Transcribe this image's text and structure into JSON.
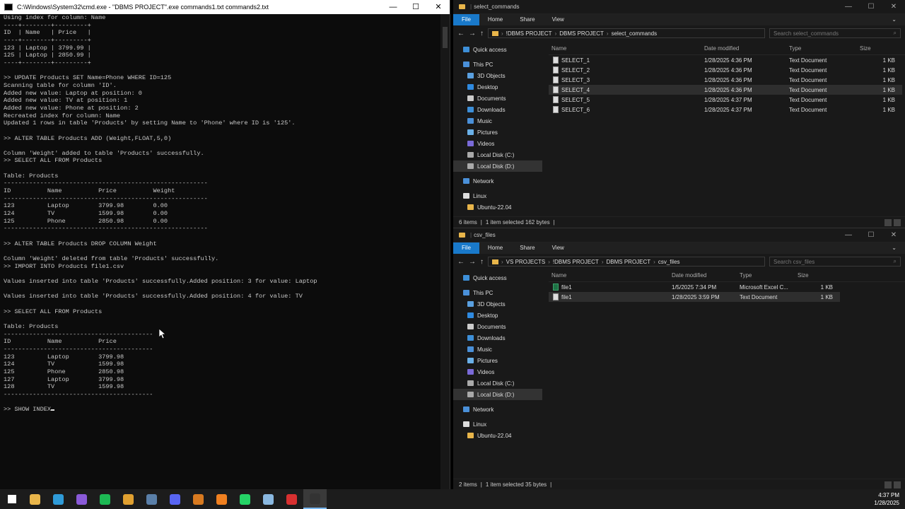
{
  "cmd": {
    "title": "C:\\Windows\\System32\\cmd.exe - \"DBMS PROJECT\".exe  commands1.txt commands2.txt",
    "lines": [
      "Using index for column: Name",
      "----+--------+---------+",
      "ID  | Name   | Price   |",
      "----+--------+---------+",
      "123 | Laptop | 3799.99 |",
      "125 | Laptop | 2850.99 |",
      "----+--------+---------+",
      "",
      ">> UPDATE Products SET Name=Phone WHERE ID=125",
      "Scanning table for column 'ID'.",
      "Added new value: Laptop at position: 0",
      "Added new value: TV at position: 1",
      "Added new value: Phone at position: 2",
      "Recreated index for column: Name",
      "Updated 1 rows in table 'Products' by setting Name to 'Phone' where ID is '125'.",
      "",
      ">> ALTER TABLE Products ADD (Weight,FLOAT,5,0)",
      "",
      "Column 'Weight' added to table 'Products' successfully.",
      ">> SELECT ALL FROM Products",
      "",
      "Table: Products",
      "--------------------------------------------------------",
      "ID          Name          Price          Weight",
      "--------------------------------------------------------",
      "123         Laptop        3799.98        0.00",
      "124         TV            1599.98        0.00",
      "125         Phone         2850.98        0.00",
      "--------------------------------------------------------",
      "",
      ">> ALTER TABLE Products DROP COLUMN Weight",
      "",
      "Column 'Weight' deleted from table 'Products' successfully.",
      ">> IMPORT INTO Products file1.csv",
      "",
      "Values inserted into table 'Products' successfully.Added position: 3 for value: Laptop",
      "",
      "Values inserted into table 'Products' successfully.Added position: 4 for value: TV",
      "",
      ">> SELECT ALL FROM Products",
      "",
      "Table: Products",
      "-----------------------------------------",
      "ID          Name          Price",
      "-----------------------------------------",
      "123         Laptop        3799.98",
      "124         TV            1599.98",
      "125         Phone         2850.98",
      "127         Laptop        3799.98",
      "128         TV            1599.98",
      "-----------------------------------------",
      "",
      ">> SHOW INDEX"
    ],
    "window_controls": [
      "—",
      "☐",
      "✕"
    ]
  },
  "explorer1": {
    "title": "select_commands",
    "tabs": [
      "File",
      "Home",
      "Share",
      "View"
    ],
    "path": [
      "!DBMS PROJECT",
      "DBMS PROJECT",
      "select_commands"
    ],
    "search_placeholder": "Search select_commands",
    "nav": [
      {
        "label": "Quick access",
        "icon": "star-icon",
        "color": "#3d8fd8",
        "indent": 0
      },
      {
        "label": "This PC",
        "icon": "pc-icon",
        "color": "#4a90d9",
        "indent": 0
      },
      {
        "label": "3D Objects",
        "icon": "cube-icon",
        "color": "#5aa0e0",
        "indent": 1
      },
      {
        "label": "Desktop",
        "icon": "desktop-icon",
        "color": "#2f8ae0",
        "indent": 1
      },
      {
        "label": "Documents",
        "icon": "document-icon",
        "color": "#cccccc",
        "indent": 1
      },
      {
        "label": "Downloads",
        "icon": "download-icon",
        "color": "#3d8fd8",
        "indent": 1
      },
      {
        "label": "Music",
        "icon": "music-icon",
        "color": "#4a90d9",
        "indent": 1
      },
      {
        "label": "Pictures",
        "icon": "picture-icon",
        "color": "#6ab0e8",
        "indent": 1
      },
      {
        "label": "Videos",
        "icon": "video-icon",
        "color": "#7a6ad8",
        "indent": 1
      },
      {
        "label": "Local Disk (C:)",
        "icon": "disk-icon",
        "color": "#aaaaaa",
        "indent": 1
      },
      {
        "label": "Local Disk (D:)",
        "icon": "disk-icon",
        "color": "#aaaaaa",
        "indent": 1,
        "selected": true
      },
      {
        "label": "Network",
        "icon": "network-icon",
        "color": "#4a90d9",
        "indent": 0
      },
      {
        "label": "Linux",
        "icon": "linux-icon",
        "color": "#dddddd",
        "indent": 0
      },
      {
        "label": "Ubuntu-22.04",
        "icon": "folder-icon",
        "color": "#e8b54a",
        "indent": 1
      }
    ],
    "columns": [
      "Name",
      "Date modified",
      "Type",
      "Size"
    ],
    "files": [
      {
        "name": "SELECT_1",
        "date": "1/28/2025 4:36 PM",
        "type": "Text Document",
        "size": "1 KB"
      },
      {
        "name": "SELECT_2",
        "date": "1/28/2025 4:36 PM",
        "type": "Text Document",
        "size": "1 KB"
      },
      {
        "name": "SELECT_3",
        "date": "1/28/2025 4:36 PM",
        "type": "Text Document",
        "size": "1 KB"
      },
      {
        "name": "SELECT_4",
        "date": "1/28/2025 4:36 PM",
        "type": "Text Document",
        "size": "1 KB",
        "selected": true
      },
      {
        "name": "SELECT_5",
        "date": "1/28/2025 4:37 PM",
        "type": "Text Document",
        "size": "1 KB"
      },
      {
        "name": "SELECT_6",
        "date": "1/28/2025 4:37 PM",
        "type": "Text Document",
        "size": "1 KB"
      }
    ],
    "status": [
      "6 items",
      "1 item selected  162 bytes"
    ]
  },
  "explorer2": {
    "title": "csv_files",
    "tabs": [
      "File",
      "Home",
      "Share",
      "View"
    ],
    "path": [
      "VS PROJECTS",
      "!DBMS PROJECT",
      "DBMS PROJECT",
      "csv_files"
    ],
    "search_placeholder": "Search csv_files",
    "nav": [
      {
        "label": "Quick access",
        "icon": "star-icon",
        "color": "#3d8fd8",
        "indent": 0
      },
      {
        "label": "This PC",
        "icon": "pc-icon",
        "color": "#4a90d9",
        "indent": 0
      },
      {
        "label": "3D Objects",
        "icon": "cube-icon",
        "color": "#5aa0e0",
        "indent": 1
      },
      {
        "label": "Desktop",
        "icon": "desktop-icon",
        "color": "#2f8ae0",
        "indent": 1
      },
      {
        "label": "Documents",
        "icon": "document-icon",
        "color": "#cccccc",
        "indent": 1
      },
      {
        "label": "Downloads",
        "icon": "download-icon",
        "color": "#3d8fd8",
        "indent": 1
      },
      {
        "label": "Music",
        "icon": "music-icon",
        "color": "#4a90d9",
        "indent": 1
      },
      {
        "label": "Pictures",
        "icon": "picture-icon",
        "color": "#6ab0e8",
        "indent": 1
      },
      {
        "label": "Videos",
        "icon": "video-icon",
        "color": "#7a6ad8",
        "indent": 1
      },
      {
        "label": "Local Disk (C:)",
        "icon": "disk-icon",
        "color": "#aaaaaa",
        "indent": 1
      },
      {
        "label": "Local Disk (D:)",
        "icon": "disk-icon",
        "color": "#aaaaaa",
        "indent": 1,
        "selected": true
      },
      {
        "label": "Network",
        "icon": "network-icon",
        "color": "#4a90d9",
        "indent": 0
      },
      {
        "label": "Linux",
        "icon": "linux-icon",
        "color": "#dddddd",
        "indent": 0
      },
      {
        "label": "Ubuntu-22.04",
        "icon": "folder-icon",
        "color": "#e8b54a",
        "indent": 1
      }
    ],
    "columns": [
      "Name",
      "Date modified",
      "Type",
      "Size"
    ],
    "files": [
      {
        "name": "file1",
        "date": "1/5/2025 7:34 PM",
        "type": "Microsoft Excel C...",
        "size": "1 KB",
        "kind": "xl"
      },
      {
        "name": "file1",
        "date": "1/28/2025 3:59 PM",
        "type": "Text Document",
        "size": "1 KB",
        "selected": true
      }
    ],
    "status": [
      "2 items",
      "1 item selected  35 bytes"
    ]
  },
  "taskbar": {
    "icons": [
      {
        "name": "windows-start-icon",
        "color": "#ffffff"
      },
      {
        "name": "file-explorer-icon",
        "color": "#e8b54a"
      },
      {
        "name": "edge-icon",
        "color": "#2f9bd8"
      },
      {
        "name": "visual-studio-icon",
        "color": "#8a5ad8"
      },
      {
        "name": "spotify-icon",
        "color": "#1db954"
      },
      {
        "name": "chrome-icon",
        "color": "#e0a030"
      },
      {
        "name": "steam-icon",
        "color": "#5a7fa8"
      },
      {
        "name": "discord-icon",
        "color": "#5865f2"
      },
      {
        "name": "app-icon",
        "color": "#d87a20"
      },
      {
        "name": "vlc-icon",
        "color": "#f08020"
      },
      {
        "name": "whatsapp-icon",
        "color": "#25d366"
      },
      {
        "name": "notes-icon",
        "color": "#8ab8e0"
      },
      {
        "name": "recorder-icon",
        "color": "#d83030"
      },
      {
        "name": "cmd-icon",
        "color": "#333333"
      }
    ],
    "time": "4:37 PM",
    "date": "1/28/2025"
  }
}
